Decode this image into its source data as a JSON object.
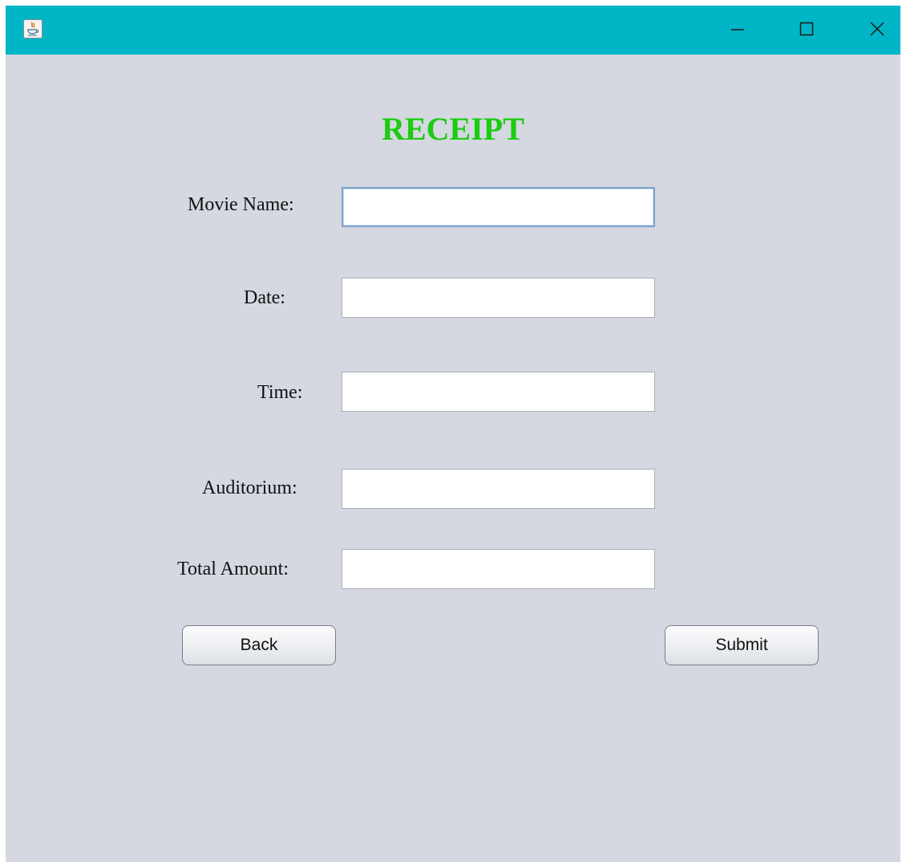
{
  "window": {
    "title": "",
    "controls": {
      "minimize_icon": "minimize-icon",
      "maximize_icon": "maximize-icon",
      "close_icon": "close-icon"
    },
    "colors": {
      "titlebar": "#00b5c5",
      "background": "#d5d8e0",
      "heading": "#1ccb12"
    }
  },
  "form": {
    "heading": "RECEIPT",
    "fields": {
      "movie_name": {
        "label": "Movie Name:",
        "value": ""
      },
      "date": {
        "label": "Date:",
        "value": ""
      },
      "time": {
        "label": "Time:",
        "value": ""
      },
      "auditorium": {
        "label": "Auditorium:",
        "value": ""
      },
      "total_amount": {
        "label": "Total Amount:",
        "value": ""
      }
    },
    "buttons": {
      "back": "Back",
      "submit": "Submit"
    }
  }
}
